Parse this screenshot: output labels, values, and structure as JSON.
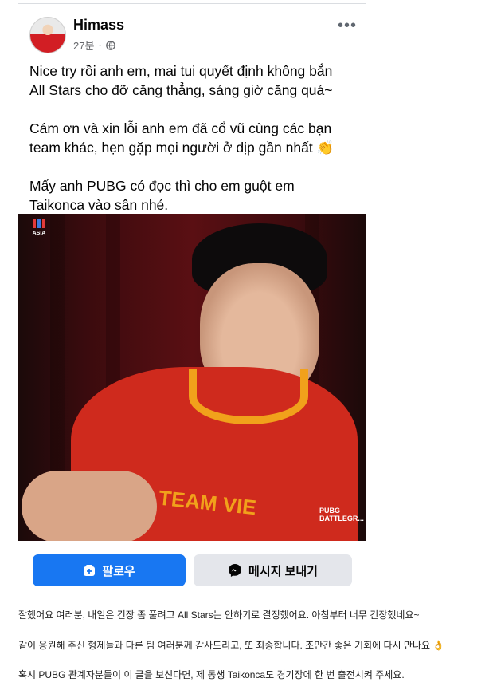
{
  "post": {
    "author": "Himass",
    "time": "27분",
    "separator": "·",
    "paragraphs": [
      "Nice try rồi anh em, mai tui quyết định không bắn\nAll Stars cho đỡ căng thẳng, sáng giờ căng quá~",
      "Cám ơn và xin lỗi anh em đã cổ vũ cùng các bạn\nteam khác, hẹn gặp mọi người ở dịp gần nhất 👏",
      "Mấy anh PUBG có đọc thì cho em guột em\nTaikonca vào sân nhé."
    ]
  },
  "photo": {
    "logo_text": "ASIA",
    "jersey_text": "TEAM VIE",
    "jersey_badge": "PUBG BATTLEGR..."
  },
  "buttons": {
    "follow_label": "팔로우",
    "message_label": "메시지 보내기"
  },
  "translation": [
    "잘했어요 여러분, 내일은 긴장 좀 풀려고 All Stars는 안하기로 결정했어요. 아침부터 너무 긴장했네요~",
    "같이 응원해 주신 형제들과 다른 팀 여러분께 감사드리고, 또 죄송합니다. 조만간 좋은 기회에 다시 만나요 👌",
    "혹시 PUBG 관계자분들이 이 글을 보신다면, 제 동생 Taikonca도 경기장에 한 번 출전시켜 주세요."
  ],
  "colors": {
    "accent": "#1877f2",
    "secondary_button": "#e4e6eb",
    "meta_text": "#65676b"
  },
  "icons": [
    "globe-icon",
    "more-options-icon",
    "follow-icon",
    "messenger-icon"
  ]
}
